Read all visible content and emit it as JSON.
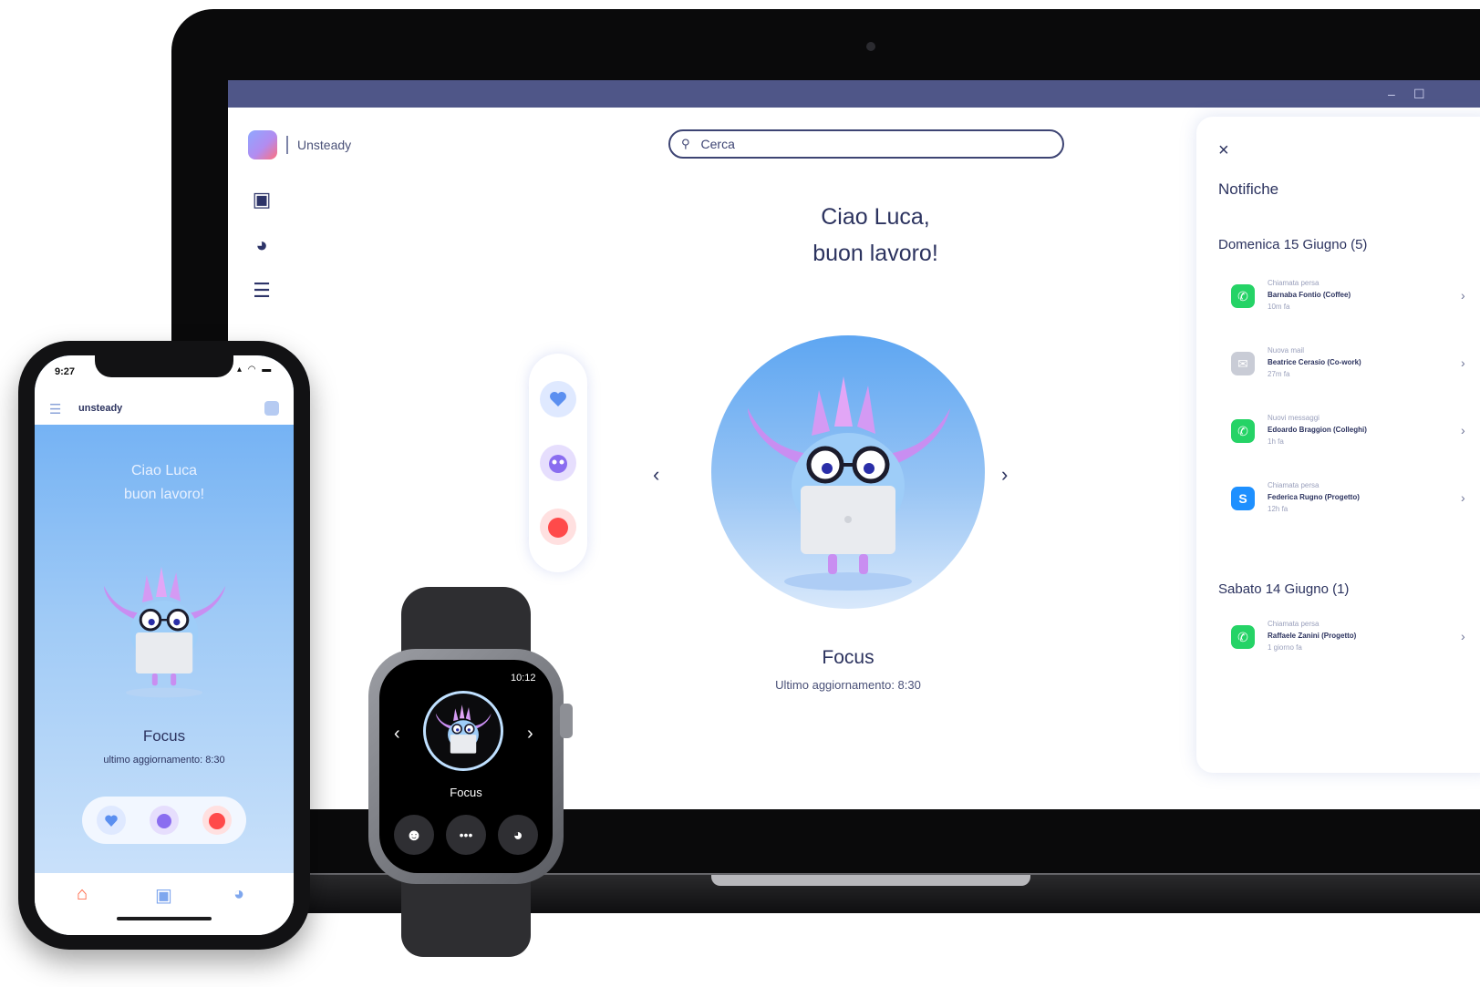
{
  "laptop": {
    "window_controls": {
      "minimize": "–",
      "maximize": "☐"
    },
    "brand": {
      "name": "Unsteady"
    },
    "sidebar": {
      "items": [
        {
          "icon": "notebook-icon",
          "glyph": "▣"
        },
        {
          "icon": "pie-chart-icon",
          "glyph": "◕"
        },
        {
          "icon": "sliders-icon",
          "glyph": "☰"
        }
      ]
    },
    "search": {
      "placeholder": "Cerca",
      "icon": "search-icon"
    },
    "greeting": {
      "line1": "Ciao Luca,",
      "line2": "buon lavoro!"
    },
    "carousel": {
      "prev": "‹",
      "next": "›"
    },
    "status": {
      "title": "Focus",
      "subtitle": "Ultimo aggiornamento: 8:30"
    },
    "mood_buttons": [
      {
        "icon": "heart-icon",
        "color": "#5b8ff0"
      },
      {
        "icon": "mascot-mood-icon",
        "color": "#8a6df0"
      },
      {
        "icon": "angry-mood-icon",
        "color": "#ff4a4a"
      }
    ],
    "notifications": {
      "close": "×",
      "title": "Notifiche",
      "groups": [
        {
          "day": "Domenica 15 Giugno (5)",
          "items": [
            {
              "app": "whatsapp",
              "app_glyph": "✆",
              "color": "#25d366",
              "line1": "Chiamata persa",
              "line2": "Barnaba Fontio (Coffee)",
              "line3": "10m fa"
            },
            {
              "app": "mail",
              "app_glyph": "✉",
              "color": "#c9ccd6",
              "line1": "Nuova mail",
              "line2": "Beatrice Cerasio (Co-work)",
              "line3": "27m fa"
            },
            {
              "app": "whatsapp",
              "app_glyph": "✆",
              "color": "#25d366",
              "line1": "Nuovi messaggi",
              "line2": "Edoardo Braggion (Colleghi)",
              "line3": "1h fa"
            },
            {
              "app": "skype",
              "app_glyph": "S",
              "color": "#1e90ff",
              "line1": "Chiamata persa",
              "line2": "Federica Rugno (Progetto)",
              "line3": "12h fa"
            }
          ]
        },
        {
          "day": "Sabato 14 Giugno (1)",
          "items": [
            {
              "app": "whatsapp",
              "app_glyph": "✆",
              "color": "#25d366",
              "line1": "Chiamata persa",
              "line2": "Raffaele Zanini (Progetto)",
              "line3": "1 giorno fa"
            }
          ]
        }
      ]
    }
  },
  "phone": {
    "time": "9:27",
    "system_icons": "▴ ◠ ▬",
    "brand": "unsteady",
    "menu_glyph": "☰",
    "greeting": {
      "line1": "Ciao Luca",
      "line2": "buon lavoro!"
    },
    "status": {
      "title": "Focus",
      "subtitle": "ultimo aggiornamento: 8:30"
    },
    "tabs": [
      {
        "icon": "home-icon",
        "glyph": "⌂",
        "color": "#ff5a36"
      },
      {
        "icon": "notebook-icon",
        "glyph": "▣",
        "color": "#7fa7ee"
      },
      {
        "icon": "pie-chart-icon",
        "glyph": "◕",
        "color": "#7fa7ee"
      }
    ]
  },
  "watch": {
    "time": "10:12",
    "label": "Focus",
    "prev": "‹",
    "next": "›",
    "buttons": [
      {
        "icon": "mood-icon",
        "glyph": "☻"
      },
      {
        "icon": "more-icon",
        "glyph": "•••"
      },
      {
        "icon": "pie-chart-icon",
        "glyph": "◕"
      }
    ]
  }
}
